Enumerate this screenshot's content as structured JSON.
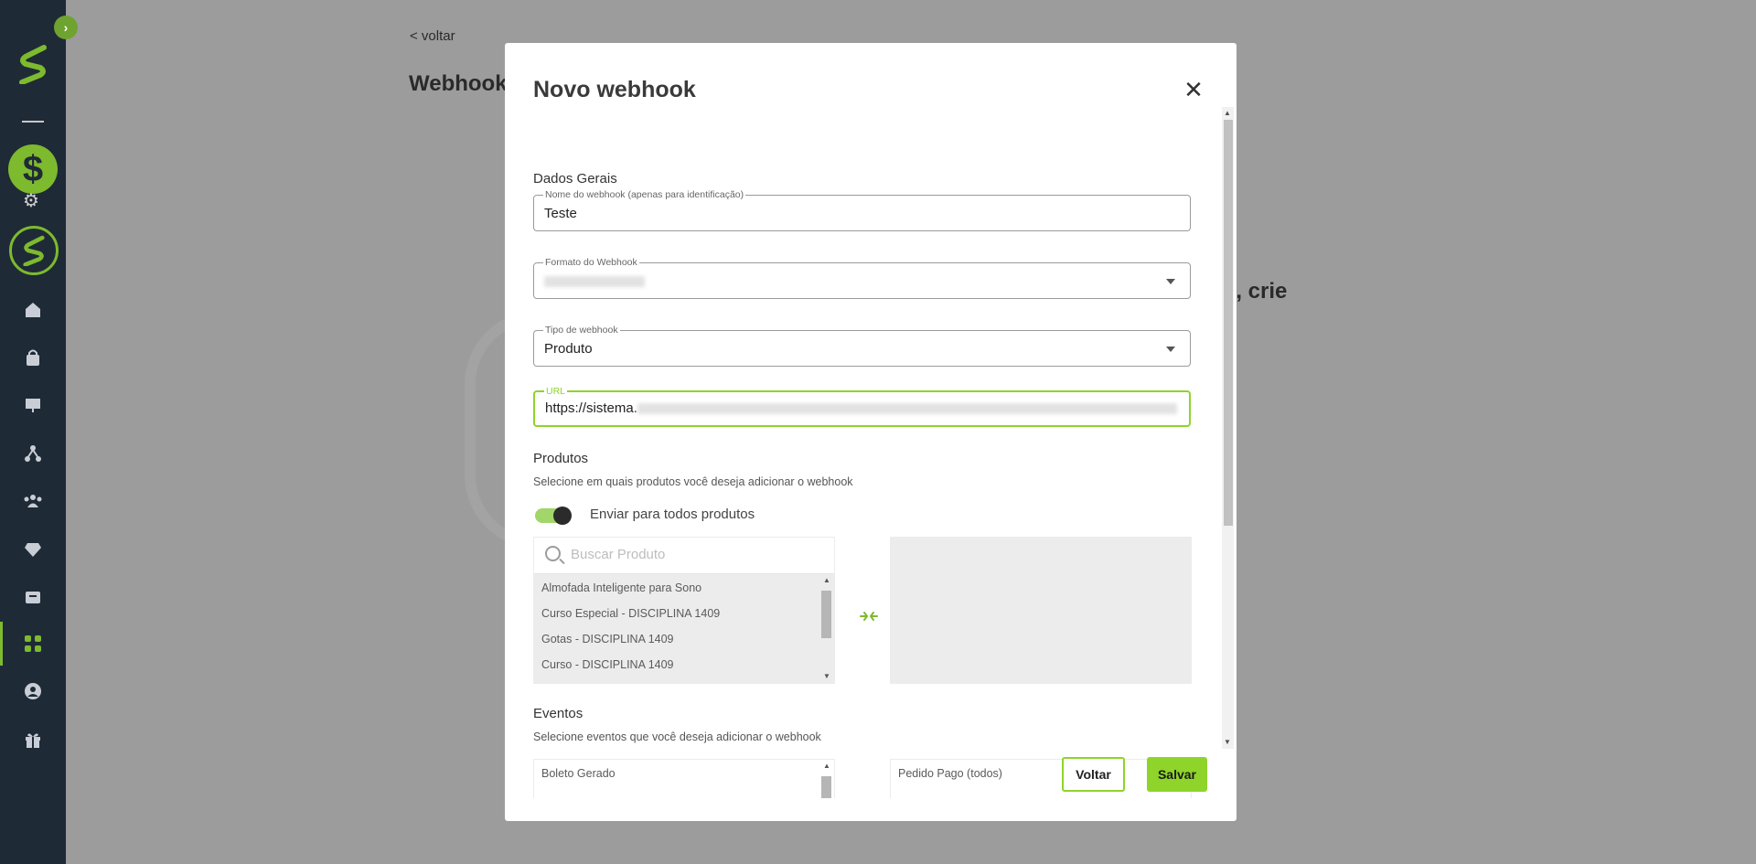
{
  "sidebar": {
    "toggle_glyph": "›",
    "logo_glyph": "S",
    "dollar_glyph": "$",
    "icons": [
      "home-icon",
      "bag-icon",
      "presentation-icon",
      "network-icon",
      "users-icon",
      "diamond-icon",
      "box-icon",
      "apps-icon",
      "user-circle-icon",
      "gift-icon"
    ],
    "active_icon": "apps-icon",
    "accent": "#7dba2e",
    "background": "#1f2a37"
  },
  "background_page": {
    "back_link": "< voltar",
    "title": "Webhook",
    "partial_text": "s, crie"
  },
  "modal": {
    "title": "Novo webhook",
    "close_glyph": "✕",
    "general": {
      "section_title": "Dados Gerais",
      "name_label": "Nome do webhook (apenas para identificação)",
      "name_value": "Teste",
      "format_label": "Formato do Webhook",
      "format_value": "",
      "type_label": "Tipo de webhook",
      "type_value": "Produto",
      "url_label": "URL",
      "url_value": "https://sistema."
    },
    "products": {
      "section_title": "Produtos",
      "subtitle": "Selecione em quais produtos você deseja adicionar o webhook",
      "toggle_label": "Enviar para todos produtos",
      "toggle_on": true,
      "search_placeholder": "Buscar Produto",
      "items": [
        "Almofada Inteligente para Sono",
        "Curso Especial - DISCIPLINA 1409",
        "Gotas - DISCIPLINA 1409",
        "Curso - DISCIPLINA 1409"
      ]
    },
    "events": {
      "section_title": "Eventos",
      "subtitle": "Selecione eventos que você deseja adicionar o webhook",
      "available": [
        "Boleto Gerado"
      ],
      "selected": [
        "Pedido Pago (todos)"
      ]
    },
    "buttons": {
      "back_label": "Voltar",
      "save_label": "Salvar"
    }
  }
}
